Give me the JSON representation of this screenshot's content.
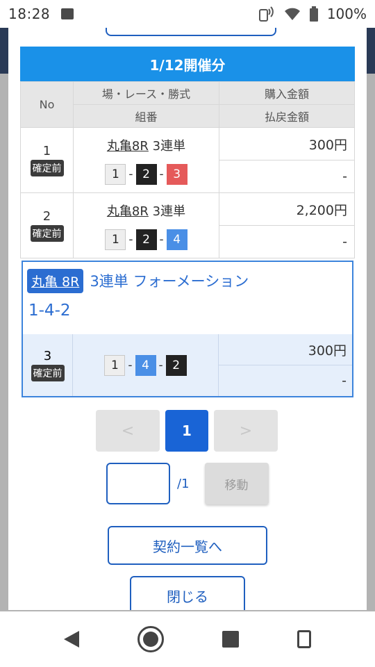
{
  "status": {
    "time": "18:28",
    "battery": "100%"
  },
  "header": {
    "title": "1/12開催分"
  },
  "table": {
    "col_no": "No",
    "col_race": "場・レース・勝式",
    "col_combo": "組番",
    "col_purchase": "購入金額",
    "col_payout": "払戻金額",
    "rows": [
      {
        "no": "1",
        "status": "確定前",
        "venue": "丸亀8R",
        "bet_type": "3連単",
        "combo": [
          "1",
          "2",
          "3"
        ],
        "purchase": "300円",
        "payout": "-"
      },
      {
        "no": "2",
        "status": "確定前",
        "venue": "丸亀8R",
        "bet_type": "3連単",
        "combo": [
          "1",
          "2",
          "4"
        ],
        "purchase": "2,200円",
        "payout": "-"
      }
    ]
  },
  "card": {
    "venue": "丸亀 8R",
    "title": "3連単 フォーメーション",
    "combo_text": "1-4-2",
    "no": "3",
    "status": "確定前",
    "combo": [
      "1",
      "4",
      "2"
    ],
    "purchase": "300円",
    "payout": "-"
  },
  "pager": {
    "prev": "<",
    "current": "1",
    "next": ">"
  },
  "jump": {
    "input_value": "",
    "total": "/1",
    "move_label": "移動"
  },
  "buttons": {
    "contract_list": "契約一覧へ",
    "close": "閉じる"
  },
  "colors": {
    "accent": "#1a91e8",
    "primary": "#1964d6",
    "red": "#e55a5a",
    "blue": "#4a8fe6",
    "black": "#222222"
  }
}
